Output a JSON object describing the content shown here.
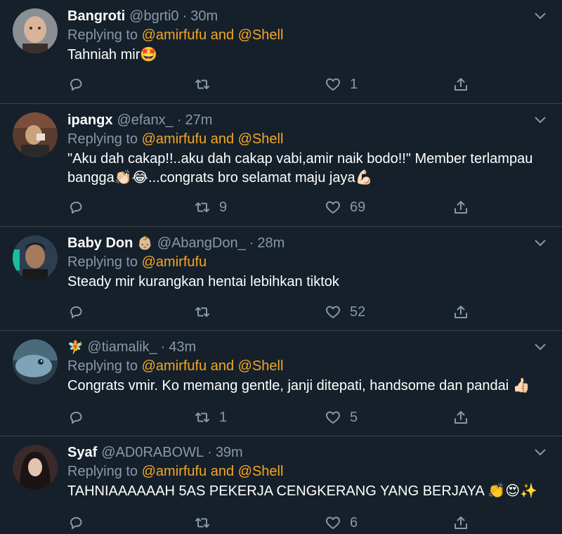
{
  "tweets": [
    {
      "name": "Bangroti",
      "name_emoji": "",
      "handle": "@bgrti0",
      "time": "30m",
      "replying_prefix": "Replying to ",
      "mentions": "@amirfufu and @Shell",
      "text": "Tahniah mir🤩",
      "reply_count": "",
      "retweet_count": "",
      "like_count": "1",
      "avatar_colors": [
        "#8a8f94",
        "#d9b49a",
        "#3a2f2a"
      ]
    },
    {
      "name": "ipangx",
      "name_emoji": "",
      "handle": "@efanx_",
      "time": "27m",
      "replying_prefix": "Replying to ",
      "mentions": "@amirfufu and @Shell",
      "text": "\"Aku dah cakap!!..aku dah cakap vabi,amir naik bodo!!\" Member terlampau bangga👏🏻😂...congrats bro selamat maju jaya💪🏻",
      "reply_count": "",
      "retweet_count": "9",
      "like_count": "69",
      "avatar_colors": [
        "#5a3b2e",
        "#2a2a2a",
        "#c9a27e"
      ]
    },
    {
      "name": "Baby Don",
      "name_emoji": "👶🏼",
      "handle": "@AbangDon_",
      "time": "28m",
      "replying_prefix": "Replying to ",
      "mentions": "@amirfufu",
      "text": "Steady mir kurangkan hentai lebihkan tiktok",
      "reply_count": "",
      "retweet_count": "",
      "like_count": "52",
      "avatar_colors": [
        "#2c3e50",
        "#a57b5c",
        "#1a1a1a"
      ]
    },
    {
      "name": "",
      "name_emoji": "🧚",
      "handle": "@tiamalik_",
      "time": "43m",
      "replying_prefix": "Replying to ",
      "mentions": "@amirfufu and @Shell",
      "text": "Congrats vmir. Ko memang gentle, janji ditepati, handsome dan pandai 👍🏻",
      "reply_count": "",
      "retweet_count": "1",
      "like_count": "5",
      "avatar_colors": [
        "#7fa3b8",
        "#4a6b7c",
        "#2d3e48"
      ]
    },
    {
      "name": "Syaf",
      "name_emoji": "",
      "handle": "@AD0RABOWL",
      "time": "39m",
      "replying_prefix": "Replying to ",
      "mentions": "@amirfufu and @Shell",
      "text": "TAHNIAAAAAAH 5AS PEKERJA CENGKERANG YANG BERJAYA 👏😍✨",
      "reply_count": "",
      "retweet_count": "",
      "like_count": "6",
      "avatar_colors": [
        "#3b2a2a",
        "#e3c4b0",
        "#1c1414"
      ]
    }
  ],
  "colors": {
    "background": "#15202b",
    "secondary_text": "#8899a6",
    "mention": "#f5a623",
    "divider": "#38444d"
  },
  "icons": [
    "reply-icon",
    "retweet-icon",
    "like-icon",
    "share-icon",
    "chevron-down-icon"
  ]
}
